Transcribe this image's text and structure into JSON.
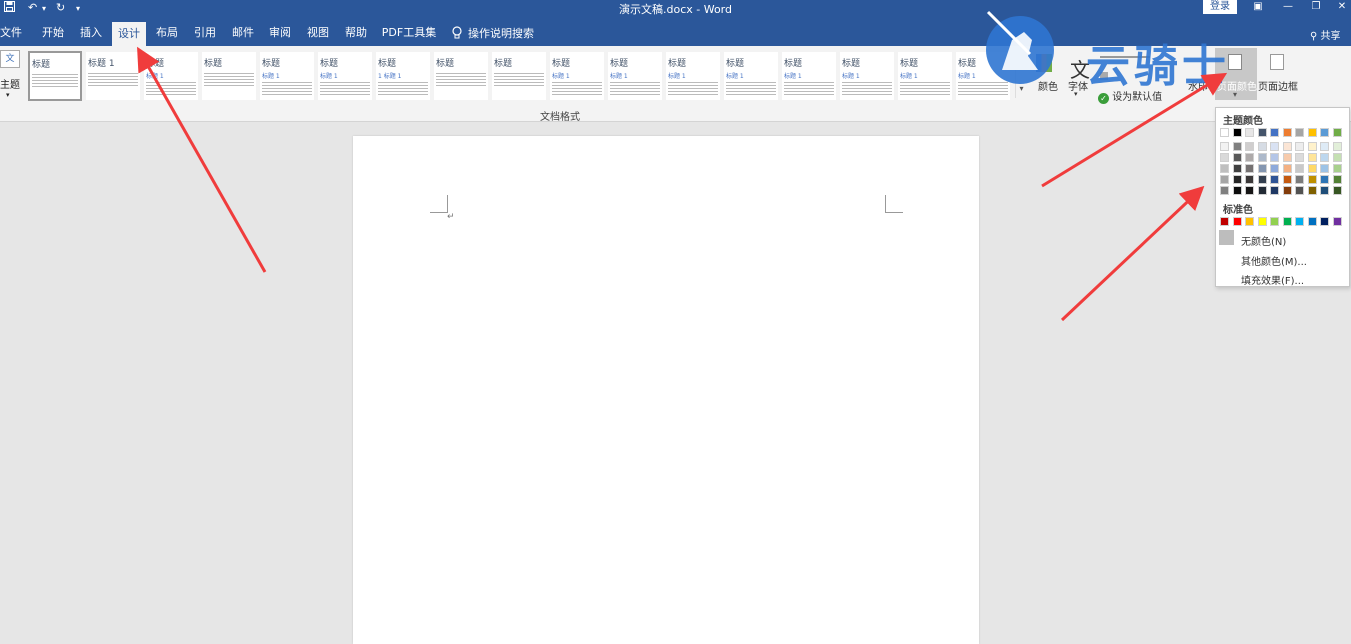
{
  "titlebar": {
    "title": "演示文稿.docx - Word",
    "login": "登录",
    "save_icon": "save-icon",
    "undo_icon": "undo-icon",
    "redo_icon": "redo-icon"
  },
  "tabs": [
    {
      "label": "文件"
    },
    {
      "label": "开始"
    },
    {
      "label": "插入"
    },
    {
      "label": "设计"
    },
    {
      "label": "布局"
    },
    {
      "label": "引用"
    },
    {
      "label": "邮件"
    },
    {
      "label": "审阅"
    },
    {
      "label": "视图"
    },
    {
      "label": "帮助"
    },
    {
      "label": "PDF工具集"
    }
  ],
  "tell_me": "操作说明搜索",
  "share": "共享",
  "ribbon": {
    "theme_label": "主题",
    "theme_box": "文",
    "group_label": "文档格式",
    "colors_label": "颜色",
    "fonts_label": "字体",
    "set_default": "设为默认值",
    "watermark_label": "水印",
    "page_color_label": "页面颜色",
    "page_borders_label": "页面边框",
    "gallery": [
      {
        "title": "标题",
        "sub": ""
      },
      {
        "title": "标题 1",
        "sub": ""
      },
      {
        "title": "标题",
        "sub": "标题 1"
      },
      {
        "title": "标题",
        "sub": ""
      },
      {
        "title": "标题",
        "sub": "标题 1"
      },
      {
        "title": "标题",
        "sub": "标题 1"
      },
      {
        "title": "标题",
        "sub": "1 标题 1"
      },
      {
        "title": "标题",
        "sub": ""
      },
      {
        "title": "标题",
        "sub": ""
      },
      {
        "title": "标题",
        "sub": "标题 1"
      },
      {
        "title": "标题",
        "sub": "标题 1"
      },
      {
        "title": "标题",
        "sub": "标题 1"
      },
      {
        "title": "标题",
        "sub": "标题 1"
      },
      {
        "title": "标题",
        "sub": "标题 1"
      },
      {
        "title": "标题",
        "sub": "标题 1"
      },
      {
        "title": "标题",
        "sub": "标题 1"
      },
      {
        "title": "标题",
        "sub": "标题 1"
      }
    ]
  },
  "watermark_logo": {
    "text": "云骑士"
  },
  "dropdown": {
    "theme_colors_title": "主题颜色",
    "standard_colors_title": "标准色",
    "no_color": "无颜色(N)",
    "more_colors": "其他颜色(M)...",
    "fill_effects": "填充效果(F)...",
    "theme_top": [
      "#ffffff",
      "#000000",
      "#e7e6e6",
      "#44546a",
      "#4472c4",
      "#ed7d31",
      "#a5a5a5",
      "#ffc000",
      "#5b9bd5",
      "#70ad47"
    ],
    "theme_columns": [
      [
        "#f2f2f2",
        "#d9d9d9",
        "#bfbfbf",
        "#a6a6a6",
        "#808080"
      ],
      [
        "#808080",
        "#595959",
        "#404040",
        "#262626",
        "#0d0d0d"
      ],
      [
        "#d0cece",
        "#aeaaaa",
        "#757171",
        "#3b3838",
        "#171616"
      ],
      [
        "#d6dce4",
        "#adb9ca",
        "#8496b0",
        "#333f4f",
        "#222a35"
      ],
      [
        "#d9e2f3",
        "#b4c6e7",
        "#8eaadb",
        "#2f5496",
        "#1f3864"
      ],
      [
        "#fbe5d5",
        "#f7cbac",
        "#f4b183",
        "#c55a11",
        "#833c0b"
      ],
      [
        "#ededed",
        "#dbdbdb",
        "#c9c9c9",
        "#7b7b7b",
        "#525252"
      ],
      [
        "#fff2cc",
        "#ffe599",
        "#ffd966",
        "#bf9000",
        "#7f6000"
      ],
      [
        "#deebf6",
        "#bdd7ee",
        "#9dc3e6",
        "#2e75b5",
        "#1f4e79"
      ],
      [
        "#e2efd9",
        "#c5e0b3",
        "#a8d08d",
        "#538135",
        "#375623"
      ]
    ],
    "standard": [
      "#c00000",
      "#ff0000",
      "#ffc000",
      "#ffff00",
      "#92d050",
      "#00b050",
      "#00b0f0",
      "#0070c0",
      "#002060",
      "#7030a0"
    ]
  }
}
